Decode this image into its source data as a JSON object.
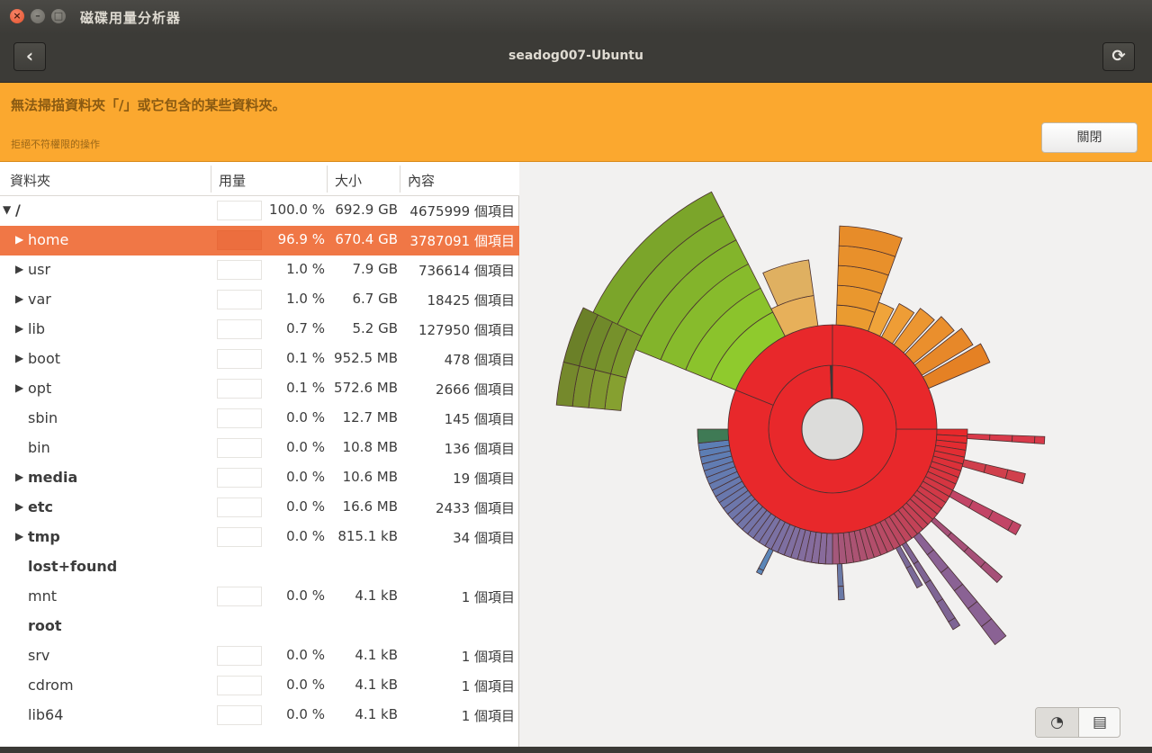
{
  "window": {
    "title": "磁碟用量分析器",
    "close_glyph": "×",
    "min_glyph": "–",
    "max_glyph": "□"
  },
  "header": {
    "hostname": "seadog007-Ubuntu",
    "back_glyph": "‹",
    "reload_glyph": "⟳"
  },
  "infobar": {
    "message": "無法掃描資料夾「/」或它包含的某些資料夾。",
    "detail": "拒絕不符權限的操作",
    "close_label": "關閉",
    "color": "#fba82f"
  },
  "columns": {
    "folder": "資料夾",
    "usage": "用量",
    "size": "大小",
    "contents": "內容"
  },
  "rows": [
    {
      "arrow": "▼",
      "name": "/",
      "pct": "100.0 %",
      "size": "692.9 GB",
      "contents": "4675999 個項目",
      "bold": true,
      "root": true,
      "selected": false
    },
    {
      "arrow": "▶",
      "name": "home",
      "pct": "96.9 %",
      "size": "670.4 GB",
      "contents": "3787091 個項目",
      "bold": false,
      "root": false,
      "selected": true
    },
    {
      "arrow": "▶",
      "name": "usr",
      "pct": "1.0 %",
      "size": "7.9 GB",
      "contents": "736614 個項目",
      "bold": false,
      "root": false,
      "selected": false
    },
    {
      "arrow": "▶",
      "name": "var",
      "pct": "1.0 %",
      "size": "6.7 GB",
      "contents": "18425 個項目",
      "bold": false,
      "root": false,
      "selected": false
    },
    {
      "arrow": "▶",
      "name": "lib",
      "pct": "0.7 %",
      "size": "5.2 GB",
      "contents": "127950 個項目",
      "bold": false,
      "root": false,
      "selected": false
    },
    {
      "arrow": "▶",
      "name": "boot",
      "pct": "0.1 %",
      "size": "952.5 MB",
      "contents": "478 個項目",
      "bold": false,
      "root": false,
      "selected": false
    },
    {
      "arrow": "▶",
      "name": "opt",
      "pct": "0.1 %",
      "size": "572.6 MB",
      "contents": "2666 個項目",
      "bold": false,
      "root": false,
      "selected": false
    },
    {
      "arrow": "",
      "name": "sbin",
      "pct": "0.0 %",
      "size": "12.7 MB",
      "contents": "145 個項目",
      "bold": false,
      "root": false,
      "selected": false
    },
    {
      "arrow": "",
      "name": "bin",
      "pct": "0.0 %",
      "size": "10.8 MB",
      "contents": "136 個項目",
      "bold": false,
      "root": false,
      "selected": false
    },
    {
      "arrow": "▶",
      "name": "media",
      "pct": "0.0 %",
      "size": "10.6 MB",
      "contents": "19 個項目",
      "bold": true,
      "root": false,
      "selected": false
    },
    {
      "arrow": "▶",
      "name": "etc",
      "pct": "0.0 %",
      "size": "16.6 MB",
      "contents": "2433 個項目",
      "bold": true,
      "root": false,
      "selected": false
    },
    {
      "arrow": "▶",
      "name": "tmp",
      "pct": "0.0 %",
      "size": "815.1 kB",
      "contents": "34 個項目",
      "bold": true,
      "root": false,
      "selected": false
    },
    {
      "arrow": "",
      "name": "lost+found",
      "pct": "",
      "size": "",
      "contents": "",
      "bold": true,
      "root": false,
      "selected": false,
      "nobar": true
    },
    {
      "arrow": "",
      "name": "mnt",
      "pct": "0.0 %",
      "size": "4.1 kB",
      "contents": "1 個項目",
      "bold": false,
      "root": false,
      "selected": false
    },
    {
      "arrow": "",
      "name": "root",
      "pct": "",
      "size": "",
      "contents": "",
      "bold": true,
      "root": false,
      "selected": false,
      "nobar": true
    },
    {
      "arrow": "",
      "name": "srv",
      "pct": "0.0 %",
      "size": "4.1 kB",
      "contents": "1 個項目",
      "bold": false,
      "root": false,
      "selected": false
    },
    {
      "arrow": "",
      "name": "cdrom",
      "pct": "0.0 %",
      "size": "4.1 kB",
      "contents": "1 個項目",
      "bold": false,
      "root": false,
      "selected": false
    },
    {
      "arrow": "",
      "name": "lib64",
      "pct": "0.0 %",
      "size": "4.1 kB",
      "contents": "1 個項目",
      "bold": false,
      "root": false,
      "selected": false
    }
  ],
  "ringchart": {
    "colors": {
      "home": "#e8282b",
      "green": "#8fca2d",
      "orange": "#ea9b30",
      "purple": "#8a6a9a",
      "blue": "#5a7fb6",
      "center": "#dcdcda"
    }
  },
  "view_switch": {
    "ring_icon": "◔",
    "tree_icon": "▤"
  },
  "accent": "#f07746"
}
